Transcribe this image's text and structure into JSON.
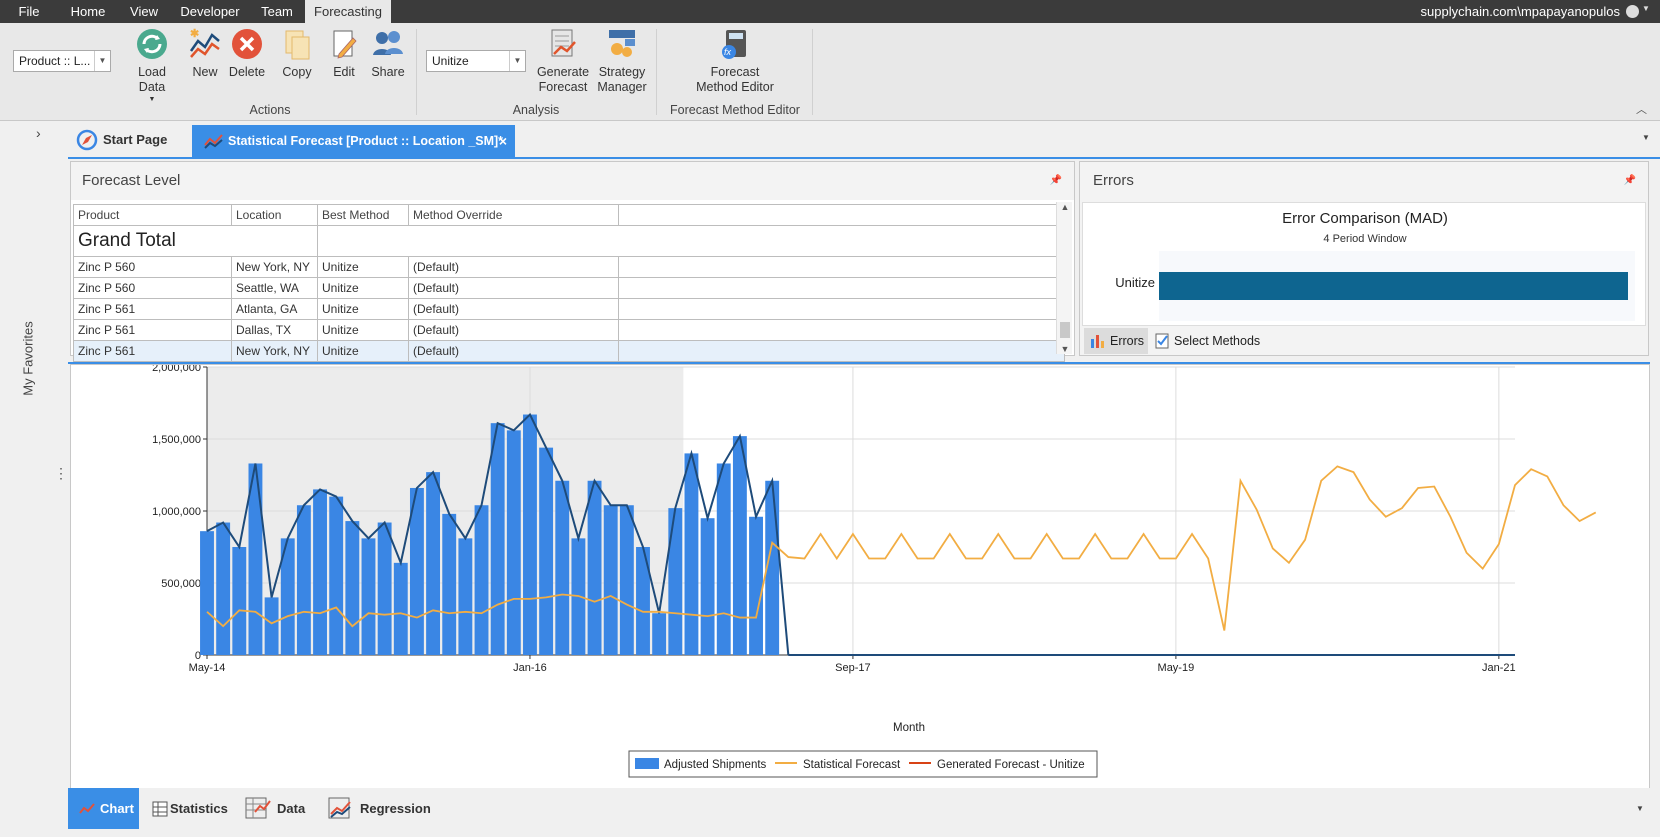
{
  "menu": {
    "tabs": [
      "File",
      "Home",
      "View",
      "Developer",
      "Team",
      "Forecasting"
    ],
    "user": "supplychain.com\\mpapayanopulos"
  },
  "ribbon": {
    "level_combo": "Product :: L...",
    "method_combo": "Unitize",
    "buttons": {
      "load_data": "Load Data",
      "new": "New",
      "delete": "Delete",
      "copy": "Copy",
      "edit": "Edit",
      "share": "Share",
      "generate_1": "Generate",
      "generate_2": "Forecast",
      "strategy_1": "Strategy",
      "strategy_2": "Manager",
      "fme_1": "Forecast",
      "fme_2": "Method Editor"
    },
    "groups": {
      "actions": "Actions",
      "analysis": "Analysis",
      "fme": "Forecast Method Editor"
    }
  },
  "sidebar": {
    "favorites": "My Favorites",
    "more": "..."
  },
  "doc_tabs": {
    "start": "Start Page",
    "active": "Statistical Forecast [Product :: Location _SM]*"
  },
  "forecast_level": {
    "title": "Forecast Level",
    "columns": [
      "Product",
      "Location",
      "Best Method",
      "Method Override"
    ],
    "grand_total": "Grand Total",
    "rows": [
      [
        "Zinc P 560",
        "New York, NY",
        "Unitize",
        "(Default)"
      ],
      [
        "Zinc P 560",
        "Seattle, WA",
        "Unitize",
        "(Default)"
      ],
      [
        "Zinc P 561",
        "Atlanta, GA",
        "Unitize",
        "(Default)"
      ],
      [
        "Zinc P 561",
        "Dallas, TX",
        "Unitize",
        "(Default)"
      ],
      [
        "Zinc P 561",
        "New York, NY",
        "Unitize",
        "(Default)"
      ]
    ]
  },
  "errors": {
    "title": "Errors",
    "chart_title": "Error Comparison (MAD)",
    "subtitle": "4 Period Window",
    "bar_label": "Unitize",
    "tab_errors": "Errors",
    "tab_select": "Select Methods",
    "bar_color": "#0e6590"
  },
  "bottom_tabs": [
    "Chart",
    "Statistics",
    "Data",
    "Regression"
  ],
  "colors": {
    "accent": "#3a8ee6",
    "bar": "#3a86e4",
    "statistical": "#f2ad43",
    "generated": "#d84315",
    "adjusted_line": "#1e4b7a"
  },
  "chart_data": {
    "type": "bar",
    "xlabel": "Month",
    "x_ticks": [
      "May-14",
      "Jan-16",
      "Sep-17",
      "May-19",
      "Jan-21"
    ],
    "y_ticks": [
      "0",
      "500,000",
      "1,000,000",
      "1,500,000",
      "2,000,000"
    ],
    "ylim": [
      0,
      2000000
    ],
    "history_months": 29,
    "total_months": 82,
    "legend": [
      "Adjusted Shipments",
      "Statistical Forecast",
      "Generated Forecast - Unitize"
    ],
    "series": [
      {
        "name": "Adjusted Shipments",
        "type": "bar",
        "values": [
          860000,
          920000,
          750000,
          1330000,
          400000,
          810000,
          1040000,
          1150000,
          1100000,
          930000,
          810000,
          920000,
          640000,
          1160000,
          1270000,
          980000,
          810000,
          1040000,
          1610000,
          1560000,
          1670000,
          1440000,
          1210000,
          810000,
          1210000,
          1040000,
          1040000,
          750000,
          290000,
          1020000,
          1400000,
          950000,
          1330000,
          1520000,
          960000,
          1210000
        ]
      },
      {
        "name": "Statistical Forecast",
        "type": "line",
        "values": [
          300000,
          200000,
          310000,
          300000,
          220000,
          270000,
          300000,
          290000,
          330000,
          200000,
          290000,
          280000,
          290000,
          260000,
          310000,
          290000,
          300000,
          290000,
          350000,
          390000,
          390000,
          400000,
          420000,
          410000,
          370000,
          410000,
          350000,
          300000,
          300000,
          290000,
          280000,
          270000,
          290000,
          260000,
          260000,
          780000,
          680000,
          670000,
          840000,
          670000,
          840000,
          670000,
          670000,
          840000,
          670000,
          670000,
          840000,
          670000,
          670000,
          840000,
          670000,
          670000,
          840000,
          670000,
          670000,
          840000,
          670000,
          670000,
          840000,
          670000,
          670000,
          840000,
          670000,
          170000,
          1210000,
          1010000,
          740000,
          640000,
          800000,
          1210000,
          1310000,
          1270000,
          1080000,
          960000,
          1020000,
          1160000,
          1170000,
          960000,
          710000,
          600000,
          770000,
          1180000,
          1290000,
          1240000,
          1040000,
          930000,
          990000
        ]
      },
      {
        "name": "Generated Forecast - Unitize",
        "type": "line",
        "values": [
          0
        ]
      }
    ]
  }
}
